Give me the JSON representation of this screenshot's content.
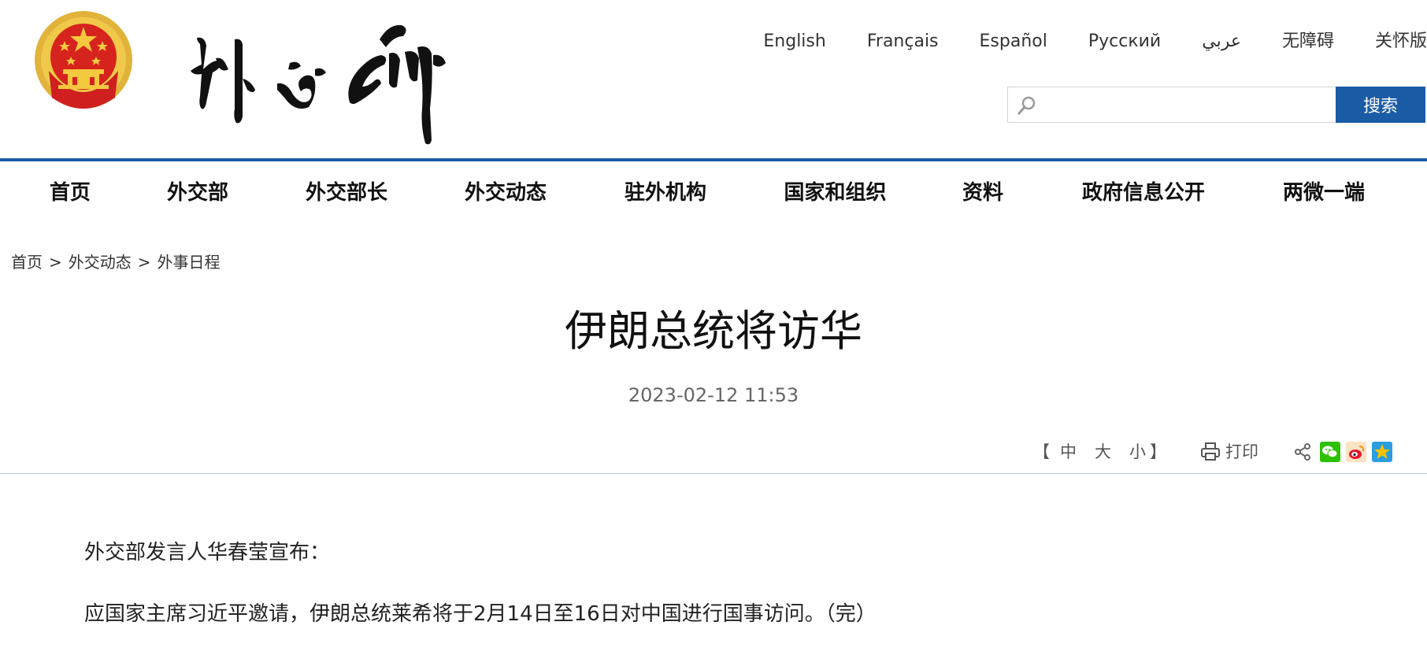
{
  "header": {
    "emblem_icon": "national-emblem-icon",
    "calligraphy_logo": "外交部",
    "languages": [
      "English",
      "Français",
      "Español",
      "Русский",
      "عربي",
      "无障碍",
      "关怀版"
    ],
    "search": {
      "placeholder": "",
      "button_label": "搜索",
      "icon": "search-icon"
    }
  },
  "nav": {
    "items": [
      "首页",
      "外交部",
      "外交部长",
      "外交动态",
      "驻外机构",
      "国家和组织",
      "资料",
      "政府信息公开",
      "两微一端"
    ]
  },
  "breadcrumb": {
    "items": [
      "首页",
      "外交动态",
      "外事日程"
    ],
    "separator": ">"
  },
  "article": {
    "title": "伊朗总统将访华",
    "date": "2023-02-12 11:53",
    "paragraphs": [
      "外交部发言人华春莹宣布：",
      "应国家主席习近平邀请，伊朗总统莱希将于2月14日至16日对中国进行国事访问。（完）"
    ]
  },
  "toolbar": {
    "bracket_open": "【",
    "font_sizes": [
      "中",
      "大",
      "小"
    ],
    "bracket_close": "】",
    "print_label": "打印",
    "print_icon": "printer-icon",
    "share_icons": [
      "share-icon",
      "wechat-icon",
      "weibo-icon",
      "qzone-icon"
    ]
  },
  "colors": {
    "accent": "#1a5ba6",
    "rule": "#b8cde3",
    "wechat": "#2dc100",
    "weibo": "#e6162d",
    "qzone": "#f7c300"
  }
}
